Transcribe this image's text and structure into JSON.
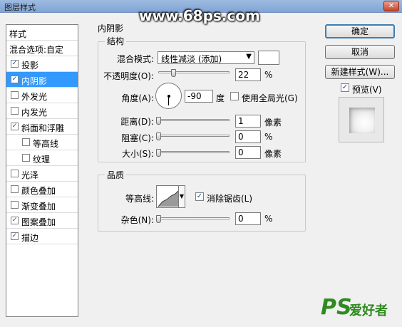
{
  "window": {
    "title": "图层样式",
    "close_label": "✕"
  },
  "watermark": "www.68ps.com",
  "styles_panel": {
    "header": "样式",
    "blending_options": "混合选项:自定",
    "items": [
      {
        "label": "投影",
        "checked": true
      },
      {
        "label": "内阴影",
        "checked": true,
        "selected": true
      },
      {
        "label": "外发光",
        "checked": false
      },
      {
        "label": "内发光",
        "checked": false
      },
      {
        "label": "斜面和浮雕",
        "checked": true
      },
      {
        "label": "等高线",
        "checked": false,
        "sub": true
      },
      {
        "label": "纹理",
        "checked": false,
        "sub": true
      },
      {
        "label": "光泽",
        "checked": false
      },
      {
        "label": "颜色叠加",
        "checked": false
      },
      {
        "label": "渐变叠加",
        "checked": false
      },
      {
        "label": "图案叠加",
        "checked": true
      },
      {
        "label": "描边",
        "checked": true
      }
    ]
  },
  "inner_shadow": {
    "section_title": "内阴影",
    "structure": {
      "title": "结构",
      "blend_mode_label": "混合模式:",
      "blend_mode_value": "线性减淡 (添加)",
      "blend_color": "#ffffff",
      "opacity_label": "不透明度(O):",
      "opacity_value": "22",
      "opacity_unit": "%",
      "angle_label": "角度(A):",
      "angle_value": "-90",
      "angle_unit": "度",
      "global_light_label": "使用全局光(G)",
      "global_light_checked": false,
      "distance_label": "距离(D):",
      "distance_value": "1",
      "distance_unit": "像素",
      "choke_label": "阻塞(C):",
      "choke_value": "0",
      "choke_unit": "%",
      "size_label": "大小(S):",
      "size_value": "0",
      "size_unit": "像素"
    },
    "quality": {
      "title": "品质",
      "contour_label": "等高线:",
      "antialias_label": "消除锯齿(L)",
      "antialias_checked": true,
      "noise_label": "杂色(N):",
      "noise_value": "0",
      "noise_unit": "%"
    }
  },
  "buttons": {
    "ok": "确定",
    "cancel": "取消",
    "new_style": "新建样式(W)...",
    "preview_label": "预览(V)",
    "preview_checked": true
  },
  "logo": {
    "ps": "PS",
    "text": "爱好者"
  }
}
